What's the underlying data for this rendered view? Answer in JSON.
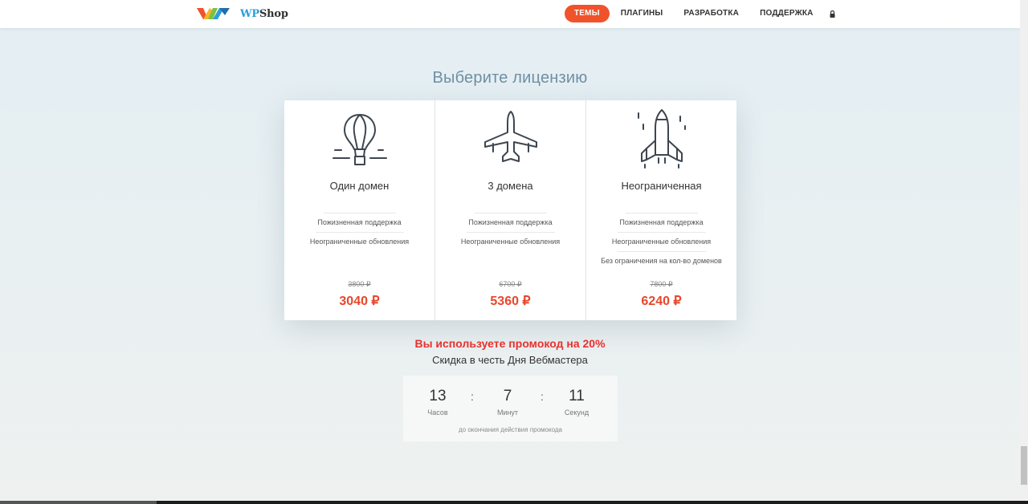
{
  "brand": {
    "logo_wp": "WP",
    "logo_shop": "Shop"
  },
  "nav": {
    "items": [
      {
        "label": "ТЕМЫ",
        "active": true
      },
      {
        "label": "ПЛАГИНЫ",
        "active": false
      },
      {
        "label": "РАЗРАБОТКА",
        "active": false
      },
      {
        "label": "ПОДДЕРЖКА",
        "active": false
      }
    ],
    "lock_icon": "lock-icon"
  },
  "section_title": "Выберите лицензию",
  "plans": [
    {
      "icon": "hot-air-balloon-icon",
      "name": "Один домен",
      "features": [
        "Пожизненная поддержка",
        "Неограниченные обновления"
      ],
      "old_price": "3800 ₽",
      "price": "3040 ₽"
    },
    {
      "icon": "airplane-icon",
      "name": "3 домена",
      "features": [
        "Пожизненная поддержка",
        "Неограниченные обновления"
      ],
      "old_price": "6700 ₽",
      "price": "5360 ₽"
    },
    {
      "icon": "rocket-icon",
      "name": "Неограниченная",
      "features": [
        "Пожизненная поддержка",
        "Неограниченные обновления",
        "Без ограничения на кол-во доменов"
      ],
      "old_price": "7800 ₽",
      "price": "6240 ₽"
    }
  ],
  "promo": {
    "title": "Вы используете промокод на 20%",
    "subtitle": "Скидка в честь Дня Вебмастера"
  },
  "timer": {
    "hours": "13",
    "hours_label": "Часов",
    "minutes": "7",
    "minutes_label": "Минут",
    "seconds": "11",
    "seconds_label": "Секунд",
    "separator": ":",
    "note": "до окончания действия промокода"
  },
  "colors": {
    "accent": "#f0532b",
    "price": "#e8462a",
    "promo": "#e8312d",
    "title": "#6f8fa3"
  }
}
